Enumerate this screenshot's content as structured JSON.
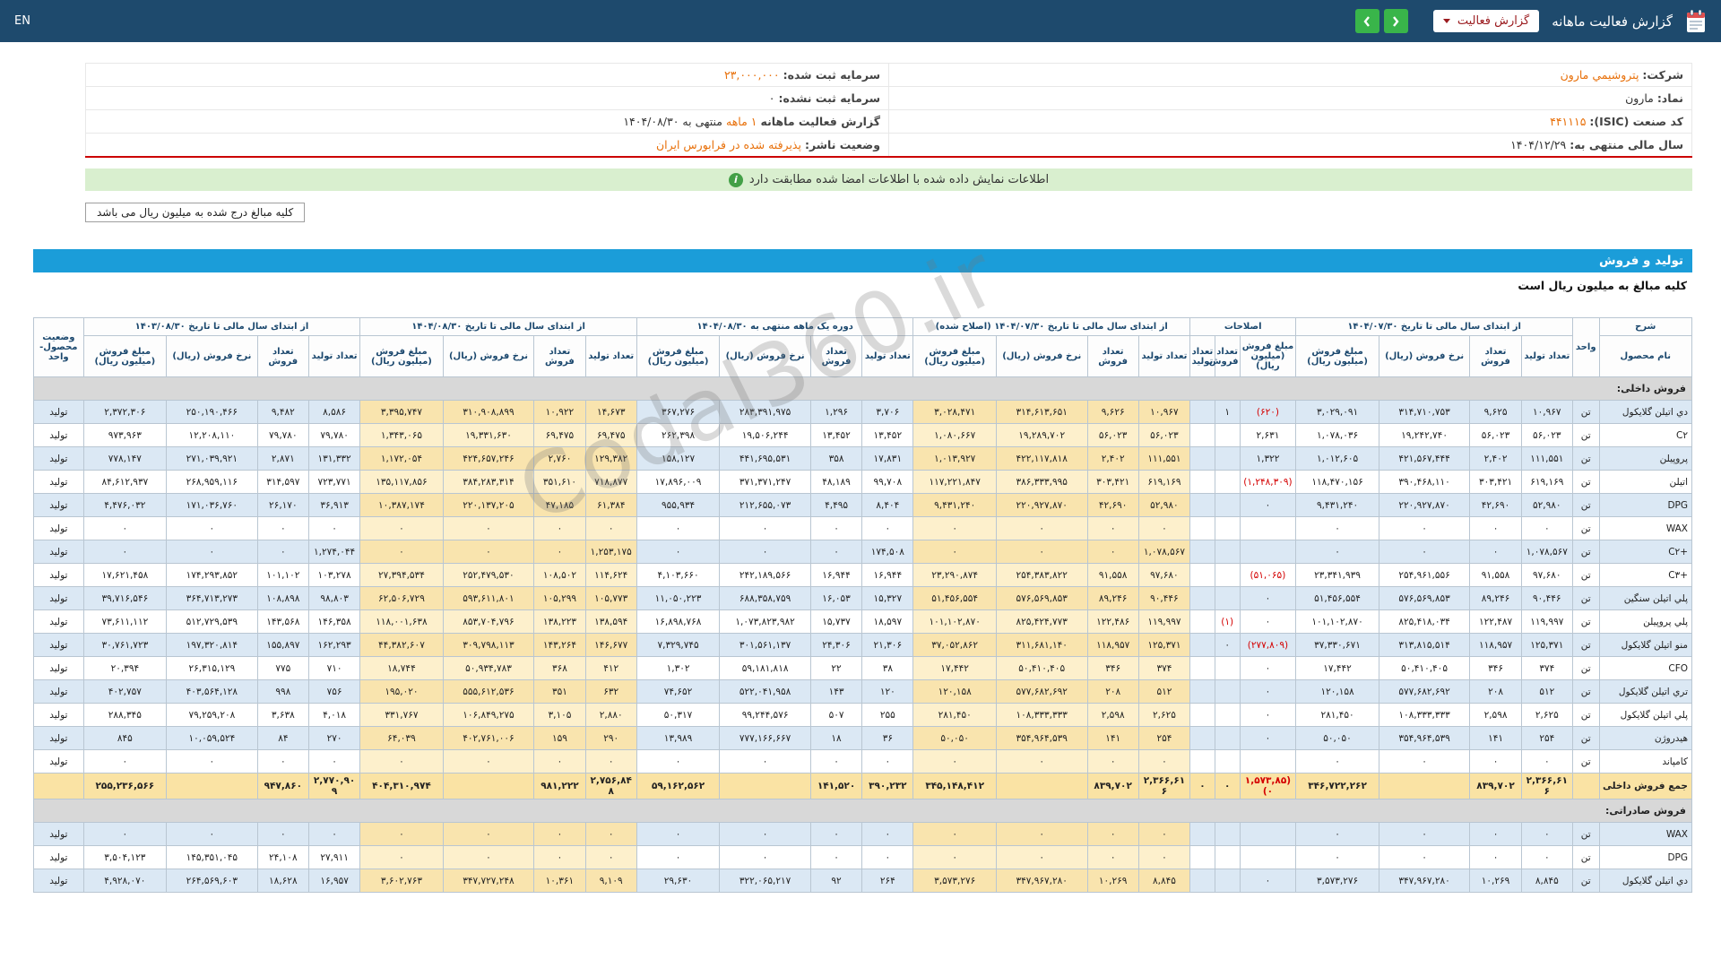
{
  "colors": {
    "topbar": "#1e4a6d",
    "green": "#39b54a",
    "dark_red": "#9b1b1f",
    "orange": "#e8700a",
    "red_line": "#cc0000",
    "banner": "#d9efcf",
    "blue": "#1b9dd9",
    "neg": "#d40000",
    "stripe": "#dbe8f4",
    "cream": "#f9e4ae",
    "section_gray": "#d8d8d8"
  },
  "icons": {
    "info_glyph": "i",
    "report": "report-doc",
    "prev": "chevron-left",
    "next": "chevron-right"
  },
  "topbar": {
    "lang_label": "EN",
    "title": "گزارش فعالیت ماهانه",
    "report_select_label": "گزارش فعالیت"
  },
  "company_info": {
    "rows": [
      {
        "right_label": "شرکت:",
        "right_value": "پتروشيمي مارون",
        "right_hl": true,
        "left_label": "سرمایه ثبت شده:",
        "left_value": "۲۳,۰۰۰,۰۰۰",
        "left_hl": true
      },
      {
        "right_label": "نماد:",
        "right_value": "مارون",
        "right_hl": false,
        "left_label": "سرمایه ثبت نشده:",
        "left_value": "۰",
        "left_hl": false
      },
      {
        "right_label": "کد صنعت (ISIC):",
        "right_value": "۴۴۱۱۱۵",
        "right_hl": true,
        "left_label": "گزارش فعالیت ماهانه",
        "left_value": "۱ ماهه",
        "left_hl": true,
        "left_suffix": "منتهی به ۱۴۰۴/۰۸/۳۰"
      },
      {
        "right_label": "سال مالی منتهی به:",
        "right_value": "۱۴۰۴/۱۲/۲۹",
        "right_hl": false,
        "left_label": "وضعیت ناشر:",
        "left_value": "پذیرفته شده در فرابورس ایران",
        "left_hl": true
      }
    ]
  },
  "banner": {
    "text": "اطلاعات نمایش داده شده با اطلاعات امضا شده مطابقت دارد"
  },
  "note_box": "کلیه مبالغ درج شده به میلیون ریال می باشد",
  "section": {
    "title": "تولید و فروش",
    "subtitle": "کلیه مبالغ به میلیون ریال است"
  },
  "watermark": "Codal360.ir",
  "table": {
    "desc_header": "شرح",
    "name_header": "نام محصول",
    "unit_header": "واحد",
    "status_header": "وضعیت محصول-واحد",
    "groups": [
      {
        "title": "از ابتدای سال مالی تا تاریخ ۱۴۰۴/۰۷/۳۰",
        "cols": [
          "تعداد تولید",
          "تعداد فروش",
          "نرخ فروش (ریال)",
          "مبلغ فروش (میلیون ریال)"
        ]
      },
      {
        "title": "اصلاحات",
        "cols": [
          "مبلغ فروش (میلیون ریال)",
          "تعداد فروش",
          "تعداد تولید"
        ]
      },
      {
        "title": "از ابتدای سال مالی تا تاریخ ۱۴۰۴/۰۷/۳۰ (اصلاح شده)",
        "cream": true,
        "cols": [
          "تعداد تولید",
          "تعداد فروش",
          "نرخ فروش (ریال)",
          "مبلغ فروش (میلیون ریال)"
        ]
      },
      {
        "title": "دوره یک ماهه منتهی به ۱۴۰۴/۰۸/۳۰",
        "cols": [
          "تعداد تولید",
          "تعداد فروش",
          "نرخ فروش (ریال)",
          "مبلغ فروش (میلیون ریال)"
        ]
      },
      {
        "title": "از ابتدای سال مالی تا تاریخ ۱۴۰۴/۰۸/۳۰",
        "cream": true,
        "cols": [
          "تعداد تولید",
          "تعداد فروش",
          "نرخ فروش (ریال)",
          "مبلغ فروش (میلیون ریال)"
        ]
      },
      {
        "title": "از ابتدای سال مالی تا تاریخ ۱۴۰۳/۰۸/۳۰",
        "cols": [
          "تعداد تولید",
          "تعداد فروش",
          "نرخ فروش (ریال)",
          "مبلغ فروش (میلیون ریال)"
        ]
      }
    ],
    "rows": [
      {
        "type": "section",
        "name": "فروش داخلی:"
      },
      {
        "type": "data",
        "name": "دي اتيلن گلايکول",
        "unit": "تن",
        "status": "تولید",
        "cells": [
          "۱۰,۹۶۷",
          "۹,۶۲۵",
          "۳۱۴,۷۱۰,۷۵۳",
          "۳,۰۲۹,۰۹۱",
          "(۶۲۰)",
          "۱",
          "",
          "۱۰,۹۶۷",
          "۹,۶۲۶",
          "۳۱۴,۶۱۳,۶۵۱",
          "۳,۰۲۸,۴۷۱",
          "۳,۷۰۶",
          "۱,۲۹۶",
          "۲۸۳,۳۹۱,۹۷۵",
          "۳۶۷,۲۷۶",
          "۱۴,۶۷۳",
          "۱۰,۹۲۲",
          "۳۱۰,۹۰۸,۸۹۹",
          "۳,۳۹۵,۷۴۷",
          "۸,۵۸۶",
          "۹,۴۸۲",
          "۲۵۰,۱۹۰,۴۶۶",
          "۲,۳۷۲,۳۰۶"
        ]
      },
      {
        "type": "data",
        "name": "C۲",
        "unit": "تن",
        "status": "تولید",
        "cells": [
          "۵۶,۰۲۳",
          "۵۶,۰۲۳",
          "۱۹,۲۴۲,۷۴۰",
          "۱,۰۷۸,۰۳۶",
          "۲,۶۳۱",
          "",
          "",
          "۵۶,۰۲۳",
          "۵۶,۰۲۳",
          "۱۹,۲۸۹,۷۰۲",
          "۱,۰۸۰,۶۶۷",
          "۱۳,۴۵۲",
          "۱۳,۴۵۲",
          "۱۹,۵۰۶,۲۴۴",
          "۲۶۲,۳۹۸",
          "۶۹,۴۷۵",
          "۶۹,۴۷۵",
          "۱۹,۳۳۱,۶۳۰",
          "۱,۳۴۳,۰۶۵",
          "۷۹,۷۸۰",
          "۷۹,۷۸۰",
          "۱۲,۲۰۸,۱۱۰",
          "۹۷۳,۹۶۳"
        ]
      },
      {
        "type": "data",
        "name": "پروپيلن",
        "unit": "تن",
        "status": "تولید",
        "cells": [
          "۱۱۱,۵۵۱",
          "۲,۴۰۲",
          "۴۲۱,۵۶۷,۴۴۴",
          "۱,۰۱۲,۶۰۵",
          "۱,۳۲۲",
          "",
          "",
          "۱۱۱,۵۵۱",
          "۲,۴۰۲",
          "۴۲۲,۱۱۷,۸۱۸",
          "۱,۰۱۳,۹۲۷",
          "۱۷,۸۳۱",
          "۳۵۸",
          "۴۴۱,۶۹۵,۵۳۱",
          "۱۵۸,۱۲۷",
          "۱۲۹,۳۸۲",
          "۲,۷۶۰",
          "۴۲۴,۶۵۷,۲۴۶",
          "۱,۱۷۲,۰۵۴",
          "۱۳۱,۳۳۲",
          "۲,۸۷۱",
          "۲۷۱,۰۳۹,۹۲۱",
          "۷۷۸,۱۴۷"
        ]
      },
      {
        "type": "data",
        "name": "اتيلن",
        "unit": "تن",
        "status": "تولید",
        "cells": [
          "۶۱۹,۱۶۹",
          "۳۰۳,۴۲۱",
          "۳۹۰,۴۶۸,۱۱۰",
          "۱۱۸,۴۷۰,۱۵۶",
          "(۱,۲۴۸,۳۰۹)",
          "",
          "",
          "۶۱۹,۱۶۹",
          "۳۰۳,۴۲۱",
          "۳۸۶,۳۳۳,۹۹۵",
          "۱۱۷,۲۲۱,۸۴۷",
          "۹۹,۷۰۸",
          "۴۸,۱۸۹",
          "۳۷۱,۳۷۱,۲۴۷",
          "۱۷,۸۹۶,۰۰۹",
          "۷۱۸,۸۷۷",
          "۳۵۱,۶۱۰",
          "۳۸۴,۲۸۳,۳۱۴",
          "۱۳۵,۱۱۷,۸۵۶",
          "۷۲۳,۷۷۱",
          "۳۱۴,۵۹۷",
          "۲۶۸,۹۵۹,۱۱۶",
          "۸۴,۶۱۲,۹۳۷"
        ]
      },
      {
        "type": "data",
        "name": "DPG",
        "unit": "تن",
        "status": "تولید",
        "cells": [
          "۵۲,۹۸۰",
          "۴۲,۶۹۰",
          "۲۲۰,۹۲۷,۸۷۰",
          "۹,۴۳۱,۲۴۰",
          "۰",
          "",
          "",
          "۵۲,۹۸۰",
          "۴۲,۶۹۰",
          "۲۲۰,۹۲۷,۸۷۰",
          "۹,۴۳۱,۲۴۰",
          "۸,۴۰۴",
          "۴,۴۹۵",
          "۲۱۲,۶۵۵,۰۷۳",
          "۹۵۵,۹۳۴",
          "۶۱,۳۸۴",
          "۴۷,۱۸۵",
          "۲۲۰,۱۳۷,۲۰۵",
          "۱۰,۳۸۷,۱۷۴",
          "۳۶,۹۱۳",
          "۲۶,۱۷۰",
          "۱۷۱,۰۳۶,۷۶۰",
          "۴,۴۷۶,۰۳۲"
        ]
      },
      {
        "type": "data",
        "name": "WAX",
        "unit": "تن",
        "status": "تولید",
        "cells": [
          "۰",
          "۰",
          "۰",
          "۰",
          "",
          "",
          "",
          "۰",
          "۰",
          "۰",
          "۰",
          "۰",
          "۰",
          "۰",
          "۰",
          "۰",
          "۰",
          "۰",
          "۰",
          "۰",
          "۰",
          "۰",
          "۰"
        ]
      },
      {
        "type": "data",
        "name": "C۲+",
        "unit": "تن",
        "status": "تولید",
        "cells": [
          "۱,۰۷۸,۵۶۷",
          "۰",
          "۰",
          "۰",
          "",
          "",
          "",
          "۱,۰۷۸,۵۶۷",
          "۰",
          "۰",
          "۰",
          "۱۷۴,۵۰۸",
          "۰",
          "۰",
          "۰",
          "۱,۲۵۳,۱۷۵",
          "۰",
          "۰",
          "۰",
          "۱,۲۷۴,۰۴۴",
          "۰",
          "۰",
          "۰"
        ]
      },
      {
        "type": "data",
        "name": "C۳+",
        "unit": "تن",
        "status": "تولید",
        "cells": [
          "۹۷,۶۸۰",
          "۹۱,۵۵۸",
          "۲۵۴,۹۶۱,۵۵۶",
          "۲۳,۳۴۱,۹۳۹",
          "(۵۱,۰۶۵)",
          "",
          "",
          "۹۷,۶۸۰",
          "۹۱,۵۵۸",
          "۲۵۴,۳۸۳,۸۲۲",
          "۲۳,۲۹۰,۸۷۴",
          "۱۶,۹۴۴",
          "۱۶,۹۴۴",
          "۲۴۲,۱۸۹,۵۶۶",
          "۴,۱۰۳,۶۶۰",
          "۱۱۴,۶۲۴",
          "۱۰۸,۵۰۲",
          "۲۵۲,۴۷۹,۵۳۰",
          "۲۷,۳۹۴,۵۳۴",
          "۱۰۳,۲۷۸",
          "۱۰۱,۱۰۲",
          "۱۷۴,۲۹۳,۸۵۲",
          "۱۷,۶۲۱,۴۵۸"
        ]
      },
      {
        "type": "data",
        "name": "پلي اتيلن سنگين",
        "unit": "تن",
        "status": "تولید",
        "cells": [
          "۹۰,۴۴۶",
          "۸۹,۲۴۶",
          "۵۷۶,۵۶۹,۸۵۳",
          "۵۱,۴۵۶,۵۵۴",
          "۰",
          "",
          "",
          "۹۰,۴۴۶",
          "۸۹,۲۴۶",
          "۵۷۶,۵۶۹,۸۵۳",
          "۵۱,۴۵۶,۵۵۴",
          "۱۵,۳۲۷",
          "۱۶,۰۵۳",
          "۶۸۸,۳۵۸,۷۵۹",
          "۱۱,۰۵۰,۲۲۳",
          "۱۰۵,۷۷۳",
          "۱۰۵,۲۹۹",
          "۵۹۳,۶۱۱,۸۰۱",
          "۶۲,۵۰۶,۷۲۹",
          "۹۸,۸۰۳",
          "۱۰۸,۸۹۸",
          "۳۶۴,۷۱۳,۲۷۳",
          "۳۹,۷۱۶,۵۴۶"
        ]
      },
      {
        "type": "data",
        "name": "پلي پروپيلن",
        "unit": "تن",
        "status": "تولید",
        "cells": [
          "۱۱۹,۹۹۷",
          "۱۲۲,۴۸۷",
          "۸۲۵,۴۱۸,۰۳۴",
          "۱۰۱,۱۰۲,۸۷۰",
          "۰",
          "(۱)",
          "",
          "۱۱۹,۹۹۷",
          "۱۲۲,۴۸۶",
          "۸۲۵,۴۲۴,۷۷۳",
          "۱۰۱,۱۰۲,۸۷۰",
          "۱۸,۵۹۷",
          "۱۵,۷۳۷",
          "۱,۰۷۳,۸۲۳,۹۸۲",
          "۱۶,۸۹۸,۷۶۸",
          "۱۳۸,۵۹۴",
          "۱۳۸,۲۲۳",
          "۸۵۳,۷۰۴,۷۹۶",
          "۱۱۸,۰۰۱,۶۳۸",
          "۱۴۶,۳۵۸",
          "۱۴۳,۵۶۸",
          "۵۱۲,۷۲۹,۵۳۹",
          "۷۳,۶۱۱,۱۱۲"
        ]
      },
      {
        "type": "data",
        "name": "منو اتيلن گلايکول",
        "unit": "تن",
        "status": "تولید",
        "cells": [
          "۱۲۵,۳۷۱",
          "۱۱۸,۹۵۷",
          "۳۱۳,۸۱۵,۵۱۴",
          "۳۷,۳۳۰,۶۷۱",
          "(۲۷۷,۸۰۹)",
          "۰",
          "",
          "۱۲۵,۳۷۱",
          "۱۱۸,۹۵۷",
          "۳۱۱,۶۸۱,۱۴۰",
          "۳۷,۰۵۲,۸۶۲",
          "۲۱,۳۰۶",
          "۲۴,۳۰۶",
          "۳۰۱,۵۶۱,۱۳۷",
          "۷,۳۲۹,۷۴۵",
          "۱۴۶,۶۷۷",
          "۱۴۳,۲۶۴",
          "۳۰۹,۷۹۸,۱۱۳",
          "۴۴,۳۸۲,۶۰۷",
          "۱۶۲,۲۹۳",
          "۱۵۵,۸۹۷",
          "۱۹۷,۳۲۰,۸۱۴",
          "۳۰,۷۶۱,۷۲۳"
        ]
      },
      {
        "type": "data",
        "name": "CFO",
        "unit": "تن",
        "status": "تولید",
        "cells": [
          "۳۷۴",
          "۳۴۶",
          "۵۰,۴۱۰,۴۰۵",
          "۱۷,۴۴۲",
          "۰",
          "",
          "",
          "۳۷۴",
          "۳۴۶",
          "۵۰,۴۱۰,۴۰۵",
          "۱۷,۴۴۲",
          "۳۸",
          "۲۲",
          "۵۹,۱۸۱,۸۱۸",
          "۱,۳۰۲",
          "۴۱۲",
          "۳۶۸",
          "۵۰,۹۳۴,۷۸۳",
          "۱۸,۷۴۴",
          "۷۱۰",
          "۷۷۵",
          "۲۶,۳۱۵,۱۲۹",
          "۲۰,۳۹۴"
        ]
      },
      {
        "type": "data",
        "name": "تري اتيلن گلايکول",
        "unit": "تن",
        "status": "تولید",
        "cells": [
          "۵۱۲",
          "۲۰۸",
          "۵۷۷,۶۸۲,۶۹۲",
          "۱۲۰,۱۵۸",
          "۰",
          "",
          "",
          "۵۱۲",
          "۲۰۸",
          "۵۷۷,۶۸۲,۶۹۲",
          "۱۲۰,۱۵۸",
          "۱۲۰",
          "۱۴۳",
          "۵۲۲,۰۴۱,۹۵۸",
          "۷۴,۶۵۲",
          "۶۳۲",
          "۳۵۱",
          "۵۵۵,۶۱۲,۵۳۶",
          "۱۹۵,۰۲۰",
          "۷۵۶",
          "۹۹۸",
          "۴۰۳,۵۶۴,۱۲۸",
          "۴۰۲,۷۵۷"
        ]
      },
      {
        "type": "data",
        "name": "پلي اتيلن گلايکول",
        "unit": "تن",
        "status": "تولید",
        "cells": [
          "۲,۶۲۵",
          "۲,۵۹۸",
          "۱۰۸,۳۳۳,۳۳۳",
          "۲۸۱,۴۵۰",
          "۰",
          "",
          "",
          "۲,۶۲۵",
          "۲,۵۹۸",
          "۱۰۸,۳۳۳,۳۳۳",
          "۲۸۱,۴۵۰",
          "۲۵۵",
          "۵۰۷",
          "۹۹,۲۴۴,۵۷۶",
          "۵۰,۳۱۷",
          "۲,۸۸۰",
          "۳,۱۰۵",
          "۱۰۶,۸۴۹,۲۷۵",
          "۳۳۱,۷۶۷",
          "۴,۰۱۸",
          "۳,۶۳۸",
          "۷۹,۲۵۹,۲۰۸",
          "۲۸۸,۳۴۵"
        ]
      },
      {
        "type": "data",
        "name": "هيدروژن",
        "unit": "تن",
        "status": "تولید",
        "cells": [
          "۲۵۴",
          "۱۴۱",
          "۳۵۴,۹۶۴,۵۳۹",
          "۵۰,۰۵۰",
          "۰",
          "",
          "",
          "۲۵۴",
          "۱۴۱",
          "۳۵۴,۹۶۴,۵۳۹",
          "۵۰,۰۵۰",
          "۳۶",
          "۱۸",
          "۷۷۷,۱۶۶,۶۶۷",
          "۱۳,۹۸۹",
          "۲۹۰",
          "۱۵۹",
          "۴۰۲,۷۶۱,۰۰۶",
          "۶۴,۰۳۹",
          "۲۷۰",
          "۸۴",
          "۱۰,۰۵۹,۵۲۴",
          "۸۴۵"
        ]
      },
      {
        "type": "data",
        "name": "کامپاند",
        "unit": "تن",
        "status": "تولید",
        "cells": [
          "۰",
          "۰",
          "۰",
          "۰",
          "",
          "",
          "",
          "۰",
          "۰",
          "۰",
          "۰",
          "۰",
          "۰",
          "۰",
          "۰",
          "۰",
          "۰",
          "۰",
          "۰",
          "۰",
          "۰",
          "۰",
          "۰"
        ]
      },
      {
        "type": "total",
        "name": "جمع فروش داخلی",
        "unit": "",
        "status": "",
        "cells": [
          "۲,۳۶۶,۶۱۶",
          "۸۳۹,۷۰۲",
          "",
          "۳۴۶,۷۲۲,۲۶۲",
          "(۱,۵۷۳,۸۵۰)",
          "۰",
          "۰",
          "۲,۳۶۶,۶۱۶",
          "۸۳۹,۷۰۲",
          "",
          "۳۴۵,۱۴۸,۴۱۲",
          "۳۹۰,۲۳۲",
          "۱۴۱,۵۲۰",
          "",
          "۵۹,۱۶۲,۵۶۲",
          "۲,۷۵۶,۸۴۸",
          "۹۸۱,۲۲۲",
          "",
          "۴۰۴,۳۱۰,۹۷۴",
          "۲,۷۷۰,۹۰۹",
          "۹۴۷,۸۶۰",
          "",
          "۲۵۵,۲۳۶,۵۶۶"
        ]
      },
      {
        "type": "section",
        "name": "فروش صادراتی:"
      },
      {
        "type": "data",
        "name": "WAX",
        "unit": "تن",
        "status": "تولید",
        "cells": [
          "۰",
          "۰",
          "۰",
          "۰",
          "",
          "",
          "",
          "۰",
          "۰",
          "۰",
          "۰",
          "۰",
          "۰",
          "۰",
          "۰",
          "۰",
          "۰",
          "۰",
          "۰",
          "۰",
          "۰",
          "۰",
          "۰"
        ]
      },
      {
        "type": "data",
        "name": "DPG",
        "unit": "تن",
        "status": "تولید",
        "cells": [
          "۰",
          "۰",
          "۰",
          "۰",
          "",
          "",
          "",
          "۰",
          "۰",
          "۰",
          "۰",
          "۰",
          "۰",
          "۰",
          "۰",
          "۰",
          "۰",
          "۰",
          "۰",
          "۲۷,۹۱۱",
          "۲۴,۱۰۸",
          "۱۴۵,۳۵۱,۰۴۵",
          "۳,۵۰۴,۱۲۳"
        ]
      },
      {
        "type": "data",
        "name": "دي اتيلن گلايکول",
        "unit": "تن",
        "status": "تولید",
        "cells": [
          "۸,۸۴۵",
          "۱۰,۲۶۹",
          "۳۴۷,۹۶۷,۲۸۰",
          "۳,۵۷۳,۲۷۶",
          "۰",
          "",
          "",
          "۸,۸۴۵",
          "۱۰,۲۶۹",
          "۳۴۷,۹۶۷,۲۸۰",
          "۳,۵۷۳,۲۷۶",
          "۲۶۴",
          "۹۲",
          "۳۲۲,۰۶۵,۲۱۷",
          "۲۹,۶۳۰",
          "۹,۱۰۹",
          "۱۰,۳۶۱",
          "۳۴۷,۷۲۷,۲۴۸",
          "۳,۶۰۲,۷۶۳",
          "۱۶,۹۵۷",
          "۱۸,۶۲۸",
          "۲۶۴,۵۶۹,۶۰۳",
          "۴,۹۲۸,۰۷۰"
        ]
      }
    ]
  }
}
